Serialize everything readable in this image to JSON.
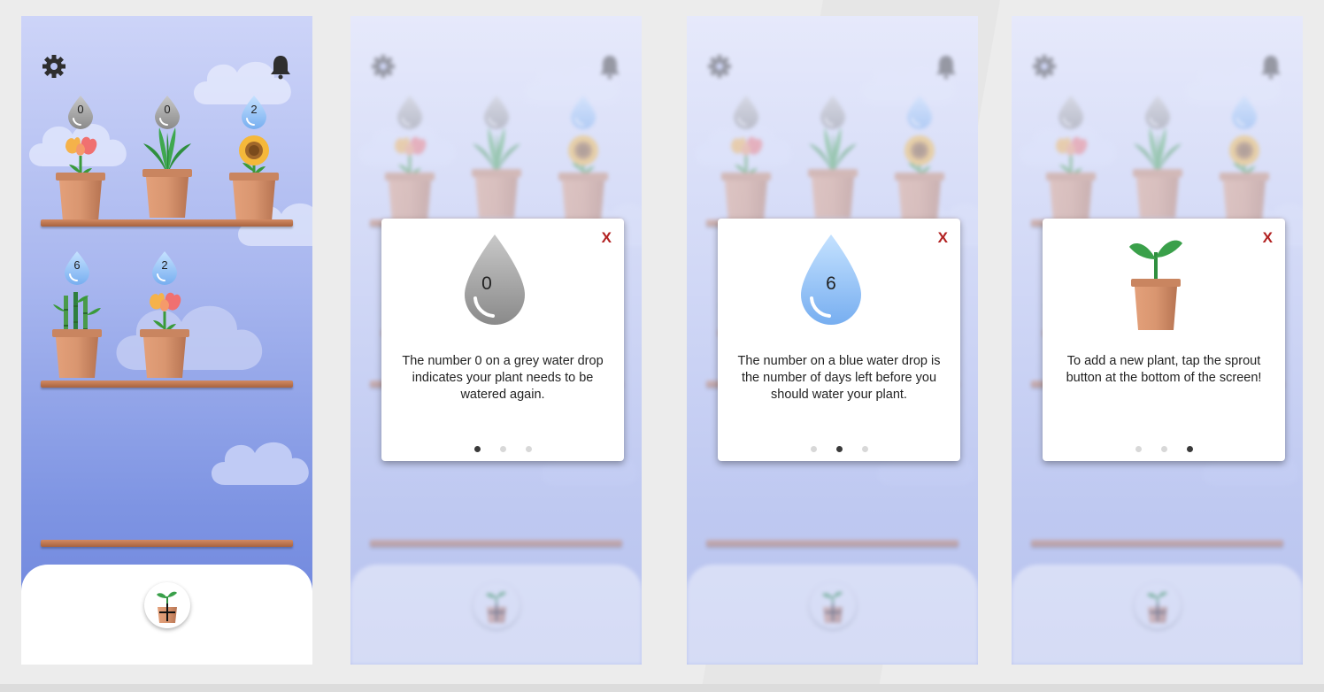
{
  "home": {
    "top_row": [
      {
        "plant": "tulip-flower",
        "water_days": "0",
        "drop_color": "grey"
      },
      {
        "plant": "aloe",
        "water_days": "0",
        "drop_color": "grey"
      },
      {
        "plant": "sunflower",
        "water_days": "2",
        "drop_color": "blue"
      }
    ],
    "middle_row": [
      {
        "plant": "bamboo",
        "water_days": "6",
        "drop_color": "blue"
      },
      {
        "plant": "tulip-flower",
        "water_days": "2",
        "drop_color": "blue"
      }
    ],
    "icons": {
      "settings": "gear-icon",
      "notifications": "bell-icon",
      "add": "sprout-pot-icon"
    }
  },
  "tutorial": [
    {
      "close_label": "X",
      "drop_number": "0",
      "drop_color": "#9a9a9a",
      "text": "The number 0 on a grey water drop indicates your plant needs to be watered again.",
      "active_dot": 0
    },
    {
      "close_label": "X",
      "drop_number": "6",
      "drop_color": "#8fc0f5",
      "text": "The number on a blue water drop is the number of days left before you should water your plant.",
      "active_dot": 1
    },
    {
      "close_label": "X",
      "icon": "sprout-pot-icon",
      "text": "To add a new plant, tap the sprout button at the bottom of the screen!",
      "active_dot": 2
    }
  ],
  "colors": {
    "grey_drop": "#9a9a9a",
    "blue_drop": "#8fc0f5",
    "close": "#b22222",
    "sky_top": "#cdd4f8",
    "sky_bottom": "#6a82dc"
  }
}
